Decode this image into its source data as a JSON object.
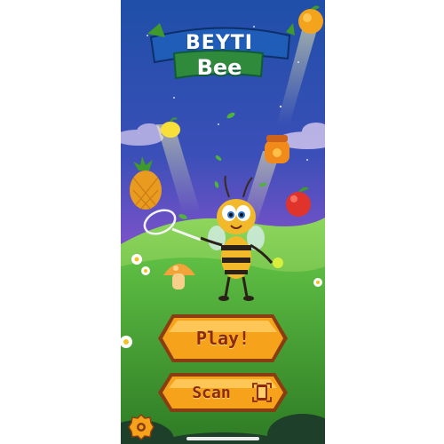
{
  "logo": {
    "brand": "BEYTI",
    "product": "Bee"
  },
  "buttons": {
    "play": "Play!",
    "scan": "Scan"
  },
  "icons": {
    "settings": "settings-gear-icon",
    "scan": "scan-phone-icon",
    "bee": "bee-mascot",
    "fruits": [
      "orange",
      "lemon",
      "honey-jar",
      "pineapple",
      "apple",
      "mushroom",
      "tennis-ball"
    ]
  },
  "colors": {
    "sky_top": "#1f4fa8",
    "sky_mid": "#6d4fc7",
    "sky_horizon": "#e58bd6",
    "grass": "#3f9a2c",
    "button_fill": "#f7a21b",
    "button_border": "#8a3d10",
    "button_text": "#8a2a06"
  }
}
